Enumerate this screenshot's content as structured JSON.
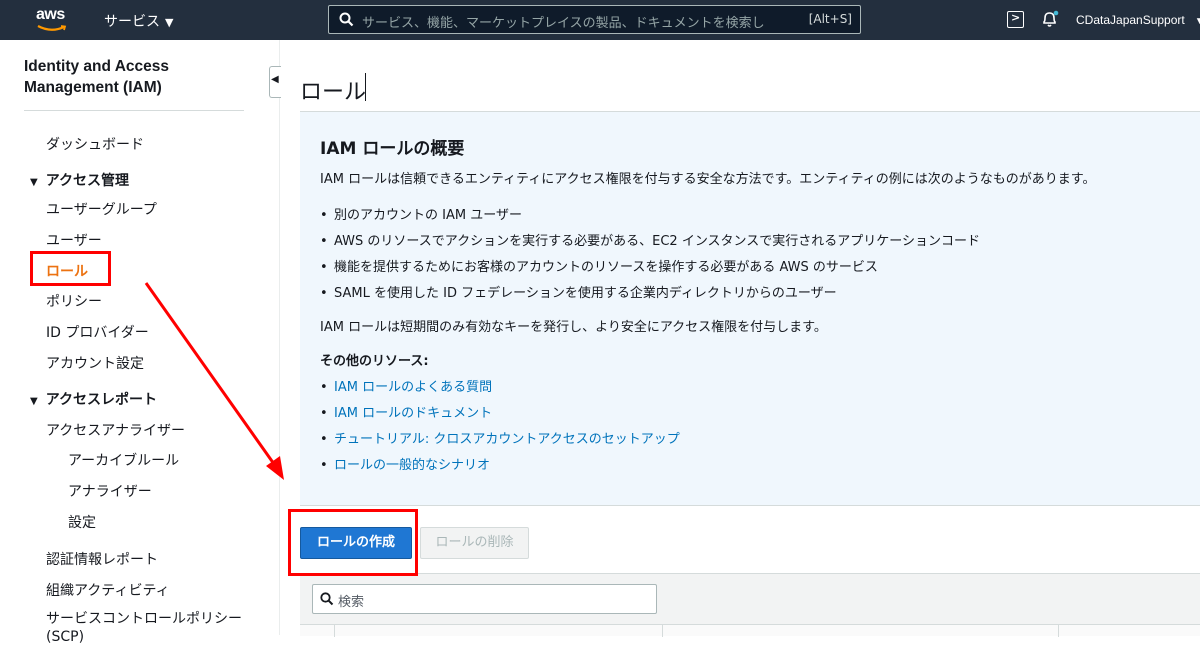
{
  "topbar": {
    "logo_text": "aws",
    "services_label": "サービス",
    "search_placeholder": "サービス、機能、マーケットプレイスの製品、ドキュメントを検索し",
    "search_shortcut": "[Alt+S]",
    "account_name": "CDataJapanSupport"
  },
  "sidebar": {
    "title": "Identity and Access Management (IAM)",
    "dashboard": "ダッシュボード",
    "access_mgmt_section": "アクセス管理",
    "access_mgmt_items": [
      "ユーザーグループ",
      "ユーザー",
      "ロール",
      "ポリシー",
      "ID プロバイダー",
      "アカウント設定"
    ],
    "access_report_section": "アクセスレポート",
    "analyzer": "アクセスアナライザー",
    "analyzer_sub": [
      "アーカイブルール",
      "アナライザー",
      "設定"
    ],
    "report_items": [
      "認証情報レポート",
      "組織アクティビティ",
      "サービスコントロールポリシー (SCP)"
    ]
  },
  "main": {
    "title": "ロール",
    "info": {
      "title": "IAM ロールの概要",
      "description": "IAM ロールは信頼できるエンティティにアクセス権限を付与する安全な方法です。エンティティの例には次のようなものがあります。",
      "examples": [
        "別のアカウントの IAM ユーザー",
        "AWS のリソースでアクションを実行する必要がある、EC2 インスタンスで実行されるアプリケーションコード",
        "機能を提供するためにお客様のアカウントのリソースを操作する必要がある AWS のサービス",
        "SAML を使用した ID フェデレーションを使用する企業内ディレクトリからのユーザー"
      ],
      "note": "IAM ロールは短期間のみ有効なキーを発行し、より安全にアクセス権限を付与します。",
      "resources_heading": "その他のリソース:",
      "resources": [
        "IAM ロールのよくある質問",
        "IAM ロールのドキュメント",
        "チュートリアル: クロスアカウントアクセスのセットアップ",
        "ロールの一般的なシナリオ"
      ]
    },
    "create_button": "ロールの作成",
    "delete_button": "ロールの削除",
    "search_placeholder": "検索"
  },
  "colors": {
    "topbar_bg": "#232f3e",
    "link": "#0073bb",
    "primary_button": "#1f77d3",
    "info_bg": "#f0f7fd",
    "annotation_red": "#ff0000"
  },
  "icons": [
    "aws-logo",
    "search-icon",
    "cloudshell-icon",
    "bell-icon",
    "caret-down-icon",
    "collapse-icon"
  ]
}
